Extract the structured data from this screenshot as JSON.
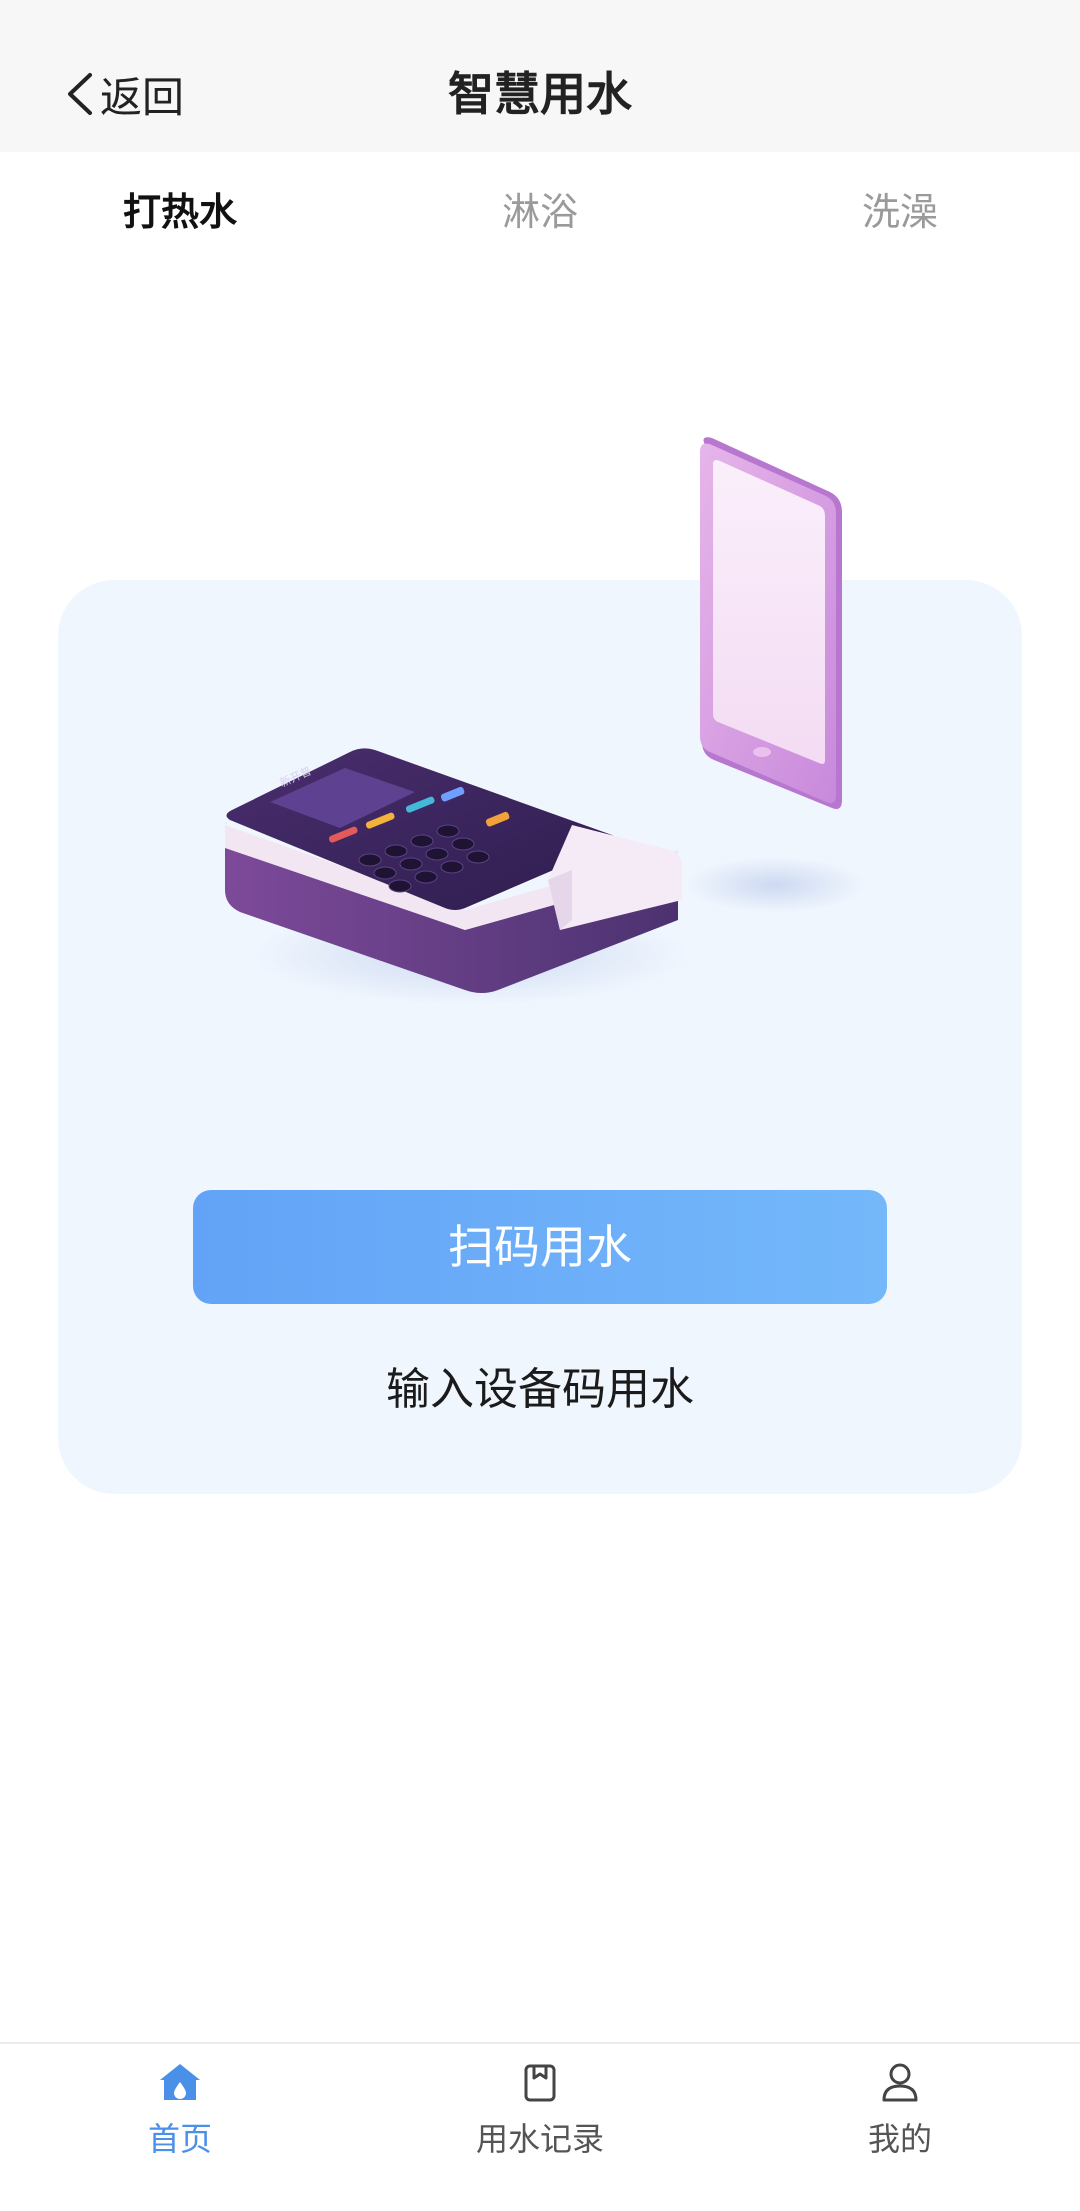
{
  "header": {
    "back_label": "返回",
    "title": "智慧用水"
  },
  "tabs": [
    {
      "label": "打热水",
      "active": true
    },
    {
      "label": "淋浴",
      "active": false
    },
    {
      "label": "洗澡",
      "active": false
    }
  ],
  "main": {
    "scan_button_label": "扫码用水",
    "input_code_label": "输入设备码用水",
    "device_brand_text": "新开普"
  },
  "bottom_nav": [
    {
      "label": "首页",
      "icon": "home-icon",
      "active": true
    },
    {
      "label": "用水记录",
      "icon": "clipboard-icon",
      "active": false
    },
    {
      "label": "我的",
      "icon": "user-icon",
      "active": false
    }
  ],
  "colors": {
    "accent": "#4a8fe8",
    "button_gradient_start": "#63a3f7",
    "button_gradient_end": "#74b8fa",
    "card_bg": "#f0f6fe",
    "header_bg": "#f7f7f7"
  }
}
